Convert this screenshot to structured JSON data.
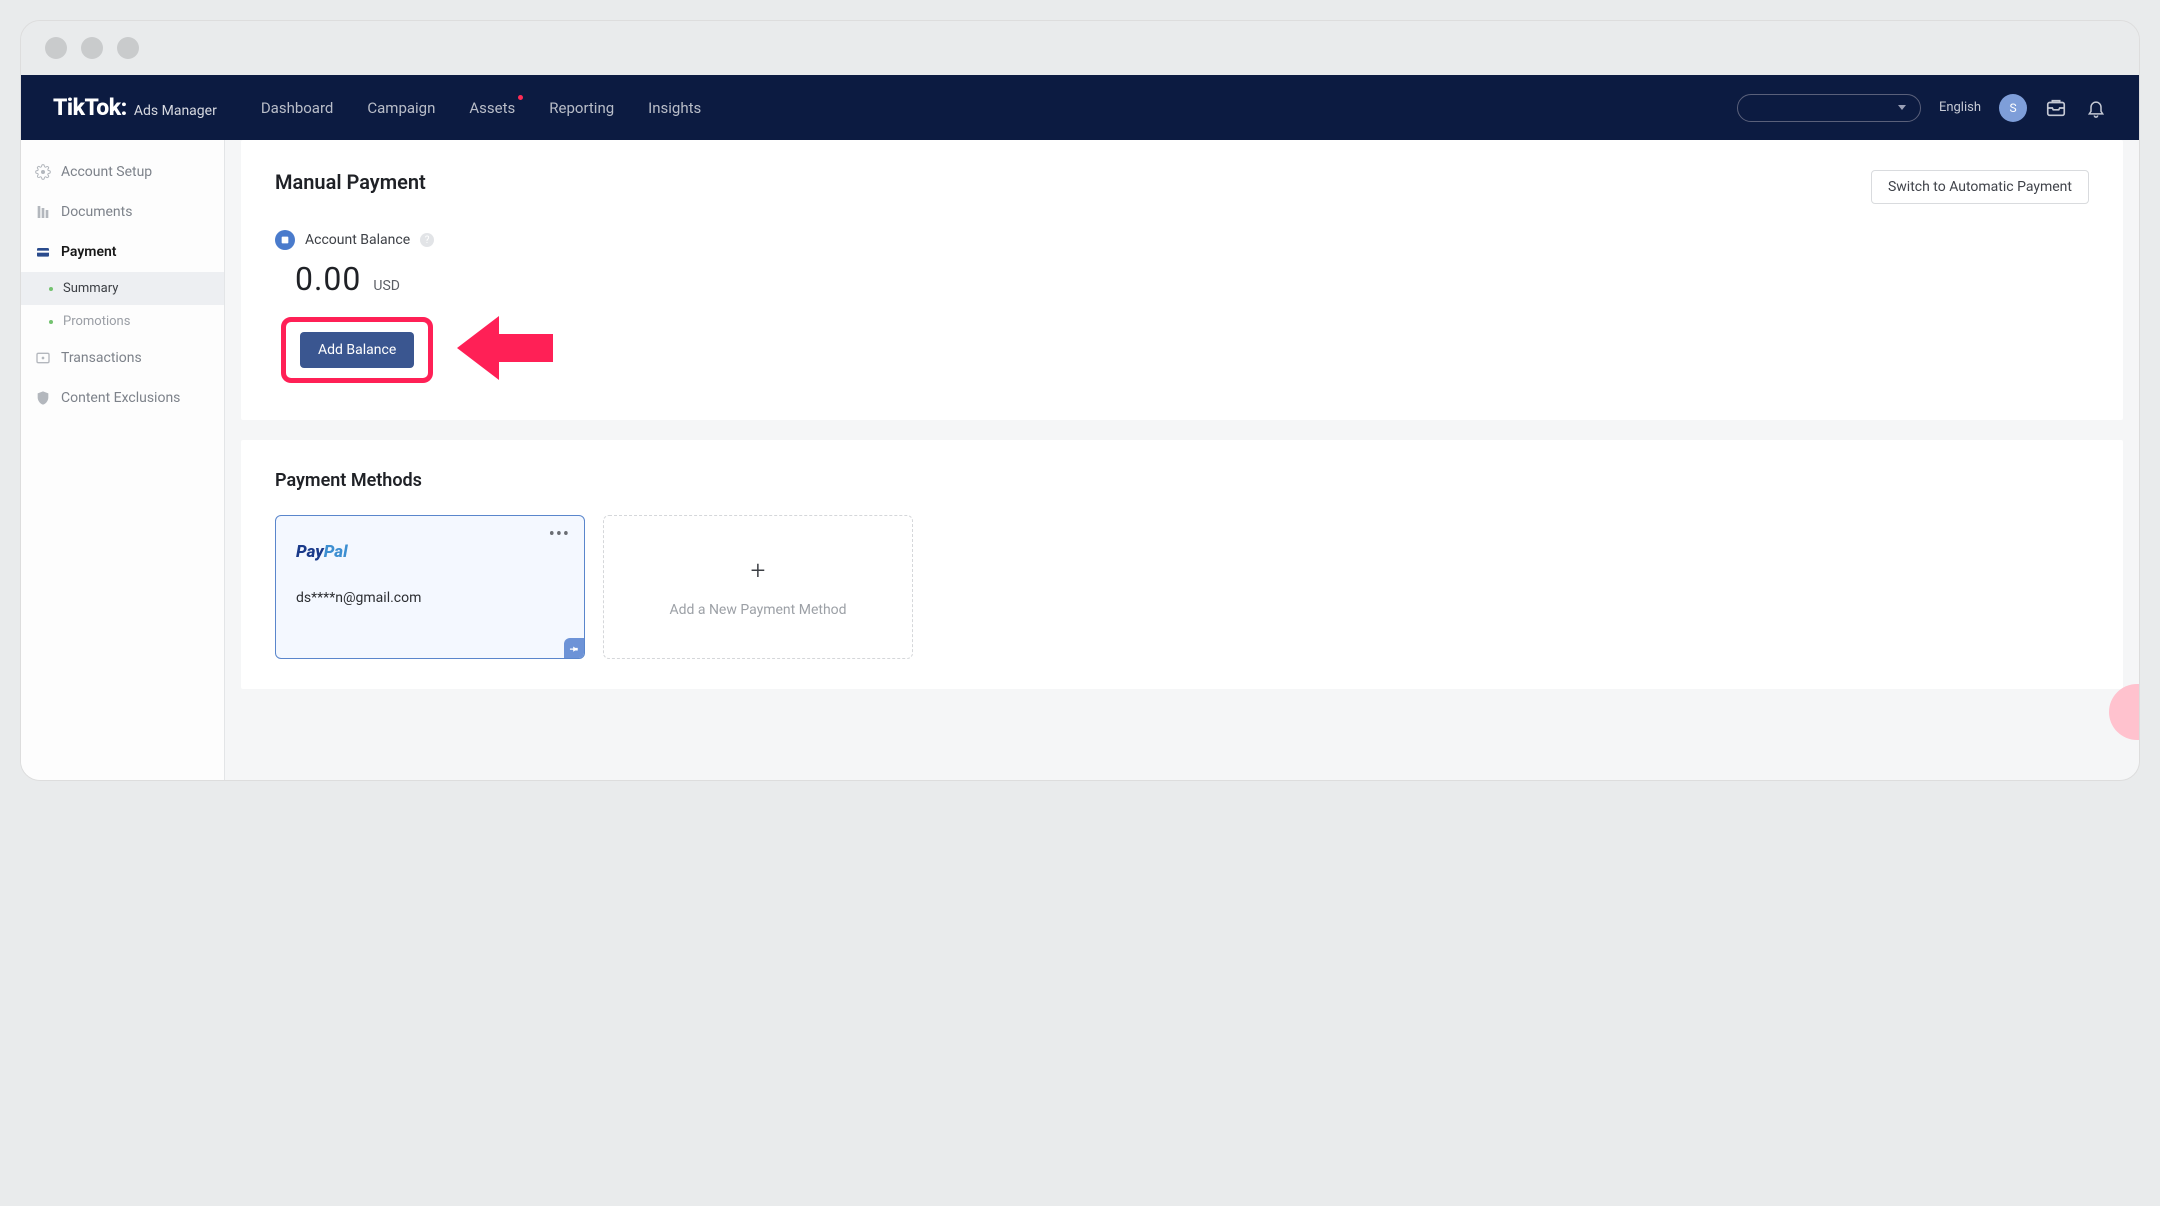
{
  "brand": {
    "logo": "TikTok:",
    "sub": "Ads Manager"
  },
  "nav": {
    "items": [
      "Dashboard",
      "Campaign",
      "Assets",
      "Reporting",
      "Insights"
    ],
    "language": "English",
    "avatar_initial": "S"
  },
  "sidebar": {
    "items": [
      {
        "label": "Account Setup"
      },
      {
        "label": "Documents"
      },
      {
        "label": "Payment"
      },
      {
        "label": "Transactions"
      },
      {
        "label": "Content Exclusions"
      }
    ],
    "sub": [
      {
        "label": "Summary"
      },
      {
        "label": "Promotions"
      }
    ]
  },
  "page": {
    "title": "Manual Payment",
    "switch_button": "Switch to Automatic Payment",
    "balance_label": "Account Balance",
    "balance_amount": "0.00",
    "balance_currency": "USD",
    "add_balance": "Add Balance"
  },
  "methods": {
    "title": "Payment Methods",
    "paypal_brand_a": "Pay",
    "paypal_brand_b": "Pal",
    "paypal_email": "ds****n@gmail.com",
    "add_text": "Add a New Payment Method"
  }
}
